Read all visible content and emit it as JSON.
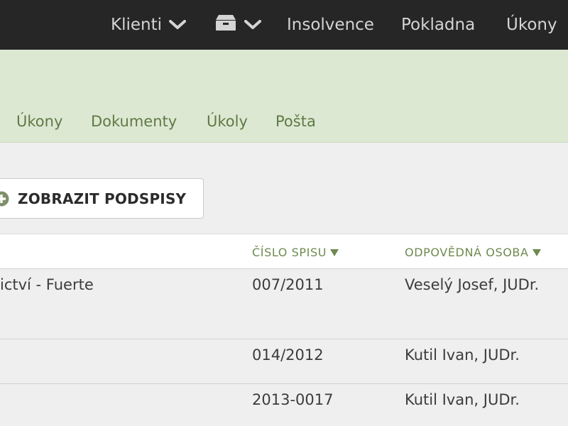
{
  "topnav": {
    "clients_label": "Klienti",
    "archive_icon": "archive-icon",
    "insolvence_label": "Insolvence",
    "pokladna_label": "Pokladna",
    "ukony_label": "Úkony"
  },
  "subnav": {
    "tabs": [
      "Úkony",
      "Dokumenty",
      "Úkoly",
      "Pošta"
    ]
  },
  "toolbar": {
    "show_subfiles_label": "ZOBRAZIT PODSPISY"
  },
  "table": {
    "columns": {
      "file_number": "ČÍSLO SPISU",
      "responsible_person": "ODPOVĚDNÁ OSOBA"
    },
    "rows": [
      {
        "name": "ictví - Fuerte",
        "file_number": "007/2011",
        "responsible_person": "Veselý Josef, JUDr."
      },
      {
        "name": "",
        "file_number": "014/2012",
        "responsible_person": "Kutil Ivan, JUDr."
      },
      {
        "name": "",
        "file_number": "2013-0017",
        "responsible_person": "Kutil Ivan, JUDr."
      }
    ]
  },
  "colors": {
    "topbar": "#262626",
    "subheader": "#dde8d3",
    "accent_green": "#6d8a4f",
    "background": "#efefef"
  }
}
